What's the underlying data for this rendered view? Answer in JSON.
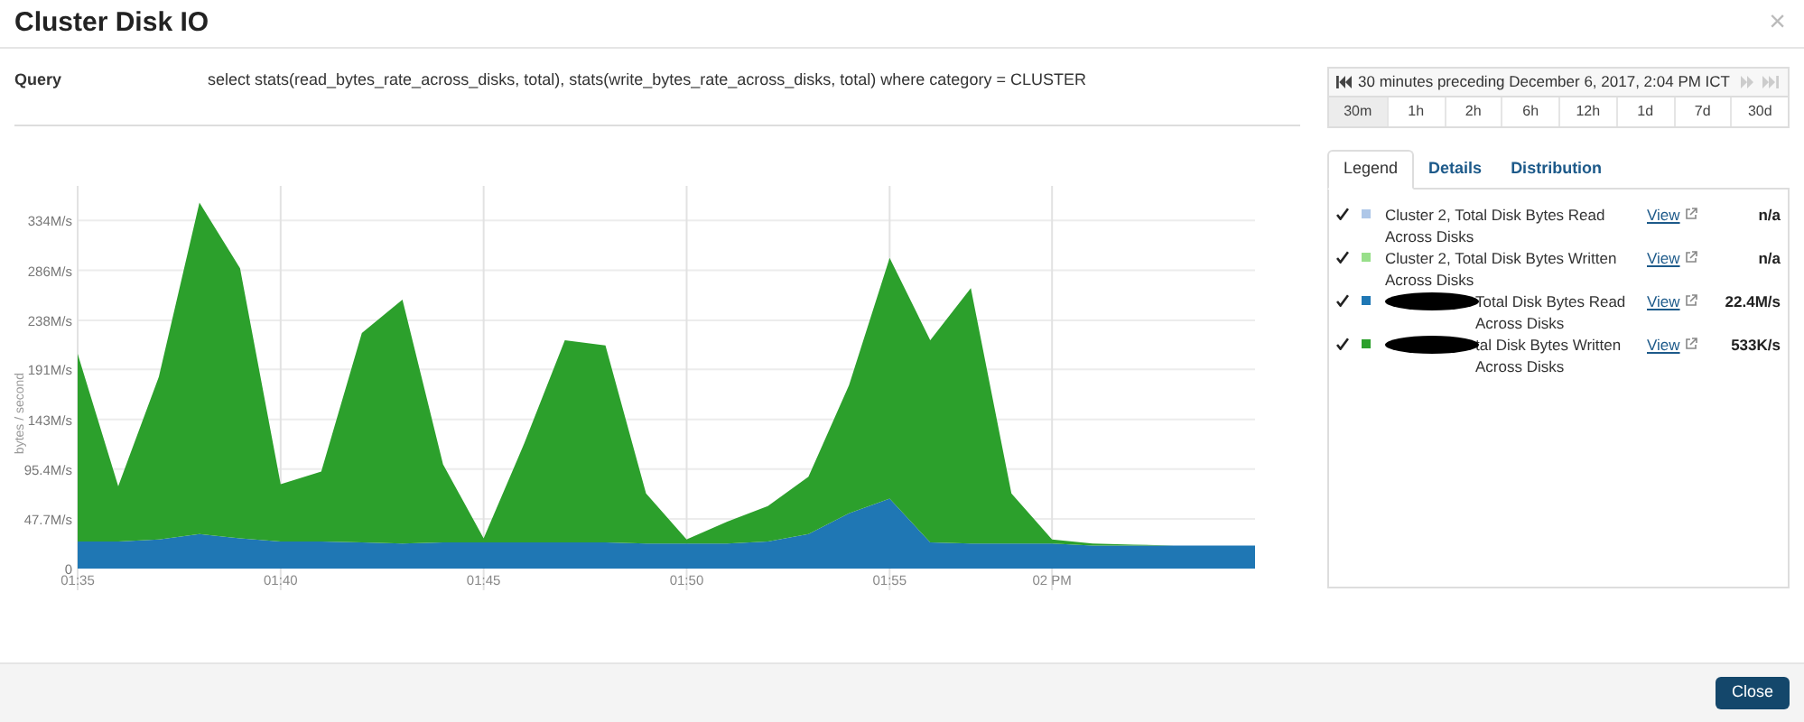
{
  "dialog": {
    "title": "Cluster Disk IO",
    "close_glyph": "×"
  },
  "query": {
    "label": "Query",
    "text": "select stats(read_bytes_rate_across_disks, total), stats(write_bytes_rate_across_disks, total) where category = CLUSTER"
  },
  "time_range": {
    "label": "30 minutes preceding December 6, 2017, 2:04 PM ICT",
    "back_enabled": true,
    "forward_enabled": false,
    "presets": [
      {
        "label": "30m",
        "selected": true
      },
      {
        "label": "1h",
        "selected": false
      },
      {
        "label": "2h",
        "selected": false
      },
      {
        "label": "6h",
        "selected": false
      },
      {
        "label": "12h",
        "selected": false
      },
      {
        "label": "1d",
        "selected": false
      },
      {
        "label": "7d",
        "selected": false
      },
      {
        "label": "30d",
        "selected": false
      }
    ]
  },
  "tabs": [
    {
      "label": "Legend",
      "selected": true
    },
    {
      "label": "Details",
      "selected": false
    },
    {
      "label": "Distribution",
      "selected": false
    }
  ],
  "legend": [
    {
      "checked": true,
      "color": "#aec7e8",
      "name": "Cluster 2, Total Disk Bytes Read Across Disks",
      "redacted": false,
      "link": "View",
      "value": "n/a"
    },
    {
      "checked": true,
      "color": "#98df8a",
      "name": "Cluster 2, Total Disk Bytes Written Across Disks",
      "redacted": false,
      "link": "View",
      "value": "n/a"
    },
    {
      "checked": true,
      "color": "#1f77b4",
      "name": "Total Disk Bytes Read Across Disks",
      "redacted": true,
      "link": "View",
      "value": "22.4M/s"
    },
    {
      "checked": true,
      "color": "#2ca02c",
      "name": "tal Disk Bytes Written Across Disks",
      "redacted": true,
      "link": "View",
      "value": "533K/s"
    }
  ],
  "chart_data": {
    "type": "area",
    "stacked": true,
    "ylabel": "bytes / second",
    "categories": [
      "01:35",
      null,
      null,
      null,
      null,
      "01:40",
      null,
      null,
      null,
      null,
      "01:45",
      null,
      null,
      null,
      null,
      "01:50",
      null,
      null,
      null,
      null,
      "01:55",
      null,
      null,
      null,
      "02 PM",
      null,
      null,
      null,
      null,
      null
    ],
    "series": [
      {
        "color": "#1f77b4",
        "values": [
          26,
          26,
          28,
          33,
          29,
          26,
          26,
          25,
          24,
          25,
          25,
          25,
          25,
          25,
          24,
          24,
          24,
          26,
          33,
          53,
          67,
          25,
          24,
          24,
          24,
          22,
          22,
          22,
          22,
          22
        ]
      },
      {
        "color": "#2ca02c",
        "values": [
          180,
          53,
          156,
          318,
          259,
          55,
          67,
          201,
          234,
          75,
          4,
          95,
          194,
          189,
          48,
          4,
          21,
          34,
          55,
          123,
          231,
          194,
          245,
          48,
          4,
          2,
          1,
          0,
          0,
          0
        ]
      }
    ],
    "grid": true,
    "ylim": [
      0,
      367
    ],
    "yticks": [
      {
        "value": 0,
        "label": "0"
      },
      {
        "value": 47.7,
        "label": "47.7M/s"
      },
      {
        "value": 95.4,
        "label": "95.4M/s"
      },
      {
        "value": 143,
        "label": "143M/s"
      },
      {
        "value": 191,
        "label": "191M/s"
      },
      {
        "value": 238,
        "label": "238M/s"
      },
      {
        "value": 286,
        "label": "286M/s"
      },
      {
        "value": 334,
        "label": "334M/s"
      }
    ]
  },
  "footer": {
    "button": "Close"
  }
}
